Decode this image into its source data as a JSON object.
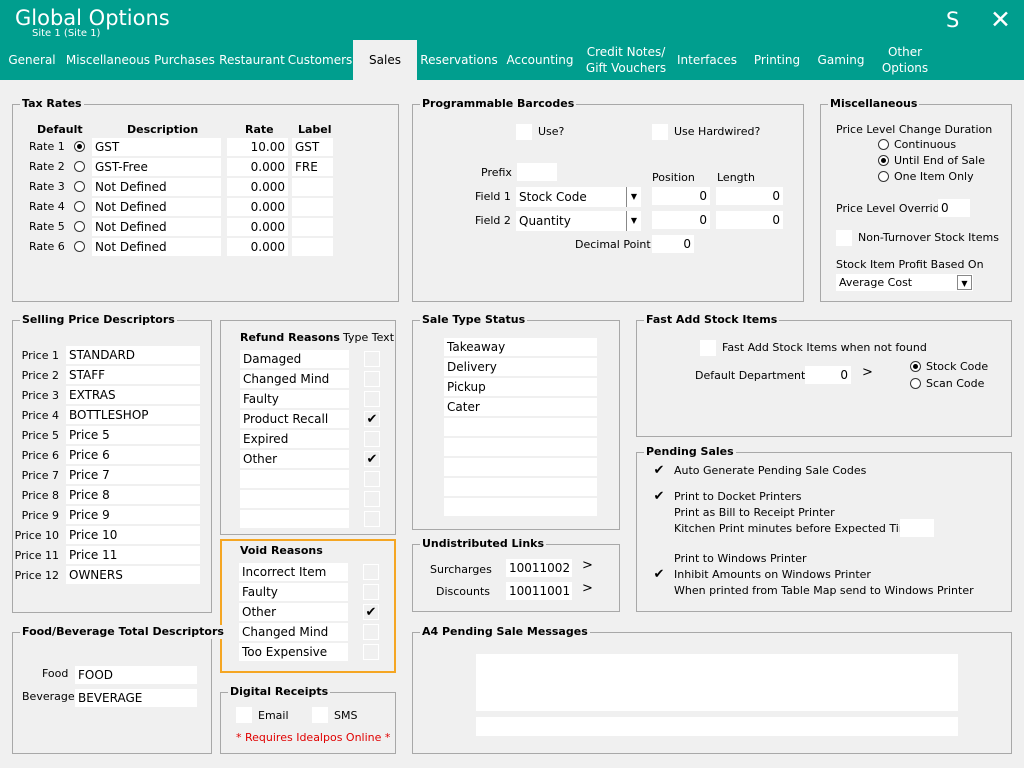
{
  "header": {
    "title": "Global Options",
    "subtitle": "Site 1  (Site 1)",
    "s_label": "S",
    "close_label": "✕"
  },
  "tabs": [
    "General",
    "Miscellaneous",
    "Purchases",
    "Restaurant",
    "Customers",
    "Sales",
    "Reservations",
    "Accounting",
    "Credit Notes/ Gift Vouchers",
    "Interfaces",
    "Printing",
    "Gaming",
    "Other Options"
  ],
  "tax": {
    "title": "Tax Rates",
    "col_default": "Default",
    "col_description": "Description",
    "col_rate": "Rate",
    "col_label": "Label",
    "rows": [
      {
        "name": "Rate 1",
        "description": "GST",
        "rate": "10.00",
        "label": "GST",
        "default": true
      },
      {
        "name": "Rate 2",
        "description": "GST-Free",
        "rate": "0.000",
        "label": "FRE",
        "default": false
      },
      {
        "name": "Rate 3",
        "description": "Not Defined",
        "rate": "0.000",
        "label": "",
        "default": false
      },
      {
        "name": "Rate 4",
        "description": "Not Defined",
        "rate": "0.000",
        "label": "",
        "default": false
      },
      {
        "name": "Rate 5",
        "description": "Not Defined",
        "rate": "0.000",
        "label": "",
        "default": false
      },
      {
        "name": "Rate 6",
        "description": "Not Defined",
        "rate": "0.000",
        "label": "",
        "default": false
      }
    ]
  },
  "barcodes": {
    "title": "Programmable Barcodes",
    "use_label": "Use?",
    "use_hardwired_label": "Use Hardwired?",
    "prefix_label": "Prefix",
    "prefix_value": "",
    "position_label": "Position",
    "length_label": "Length",
    "field1_label": "Field 1",
    "field1_value": "Stock Code",
    "field1_position": "0",
    "field1_length": "0",
    "field2_label": "Field 2",
    "field2_value": "Quantity",
    "field2_position": "0",
    "field2_length": "0",
    "decimal_label": "Decimal Point",
    "decimal_value": "0"
  },
  "misc": {
    "title": "Miscellaneous",
    "duration_label": "Price Level Change Duration",
    "opt_continuous": "Continuous",
    "opt_until_end": "Until End of Sale",
    "opt_one_item": "One Item Only",
    "override_label": "Price Level Override",
    "override_value": "0",
    "non_turnover_label": "Non-Turnover Stock Items",
    "profit_label": "Stock Item Profit Based On",
    "profit_value": "Average Cost"
  },
  "price_desc": {
    "title": "Selling Price Descriptors",
    "rows": [
      {
        "name": "Price 1",
        "value": "STANDARD"
      },
      {
        "name": "Price 2",
        "value": "STAFF"
      },
      {
        "name": "Price 3",
        "value": "EXTRAS"
      },
      {
        "name": "Price 4",
        "value": "BOTTLESHOP"
      },
      {
        "name": "Price 5",
        "value": "Price 5"
      },
      {
        "name": "Price 6",
        "value": "Price 6"
      },
      {
        "name": "Price 7",
        "value": "Price 7"
      },
      {
        "name": "Price 8",
        "value": "Price 8"
      },
      {
        "name": "Price 9",
        "value": "Price 9"
      },
      {
        "name": "Price 10",
        "value": "Price 10"
      },
      {
        "name": "Price 11",
        "value": "Price 11"
      },
      {
        "name": "Price 12",
        "value": "OWNERS"
      }
    ]
  },
  "refund": {
    "title": "Refund Reasons",
    "type_text_label": "Type Text",
    "rows": [
      {
        "label": "Damaged",
        "checked": false
      },
      {
        "label": "Changed Mind",
        "checked": false
      },
      {
        "label": "Faulty",
        "checked": false
      },
      {
        "label": "Product Recall",
        "checked": true
      },
      {
        "label": "Expired",
        "checked": false
      },
      {
        "label": "Other",
        "checked": true
      },
      {
        "label": "",
        "checked": false
      },
      {
        "label": "",
        "checked": false
      },
      {
        "label": "",
        "checked": false
      }
    ]
  },
  "void": {
    "title": "Void Reasons",
    "rows": [
      {
        "label": "Incorrect Item",
        "checked": false
      },
      {
        "label": "Faulty",
        "checked": false
      },
      {
        "label": "Other",
        "checked": true
      },
      {
        "label": "Changed Mind",
        "checked": false
      },
      {
        "label": "Too Expensive",
        "checked": false
      }
    ]
  },
  "digital": {
    "title": "Digital Receipts",
    "email_label": "Email",
    "sms_label": "SMS",
    "note": "* Requires Idealpos Online *",
    "note_color": "#e00000"
  },
  "sale_type": {
    "title": "Sale Type Status",
    "rows": [
      "Takeaway",
      "Delivery",
      "Pickup",
      "Cater",
      "",
      "",
      "",
      "",
      ""
    ]
  },
  "undistributed": {
    "title": "Undistributed Links",
    "surcharges_label": "Surcharges",
    "surcharges_value": "10011002",
    "discounts_label": "Discounts",
    "discounts_value": "10011001",
    "arrow": ">"
  },
  "fast_add": {
    "title": "Fast Add Stock Items",
    "when_not_found_label": "Fast Add Stock Items when not found",
    "dept_label": "Default Department",
    "dept_value": "0",
    "arrow": ">",
    "opt_stock_code": "Stock Code",
    "opt_scan_code": "Scan Code"
  },
  "pending": {
    "title": "Pending Sales",
    "items": [
      {
        "label": "Auto Generate Pending Sale Codes",
        "checked": true
      },
      {
        "label": "Print to Docket Printers",
        "checked": true
      },
      {
        "label": "Print as Bill to Receipt Printer",
        "checked": false
      },
      {
        "label": "Kitchen Print minutes before Expected Time",
        "checked": false
      },
      {
        "label": "Print to Windows Printer",
        "checked": false
      },
      {
        "label": "Inhibit Amounts on Windows Printer",
        "checked": true
      },
      {
        "label": "When printed from Table Map send to Windows Printer",
        "checked": false
      }
    ]
  },
  "food_bev": {
    "title": "Food/Beverage Total Descriptors",
    "food_label": "Food",
    "food_value": "FOOD",
    "beverage_label": "Beverage",
    "beverage_value": "BEVERAGE"
  },
  "a4": {
    "title": "A4 Pending Sale Messages"
  },
  "colors": {
    "header": "#009e8e",
    "highlight": "#f5a623"
  }
}
